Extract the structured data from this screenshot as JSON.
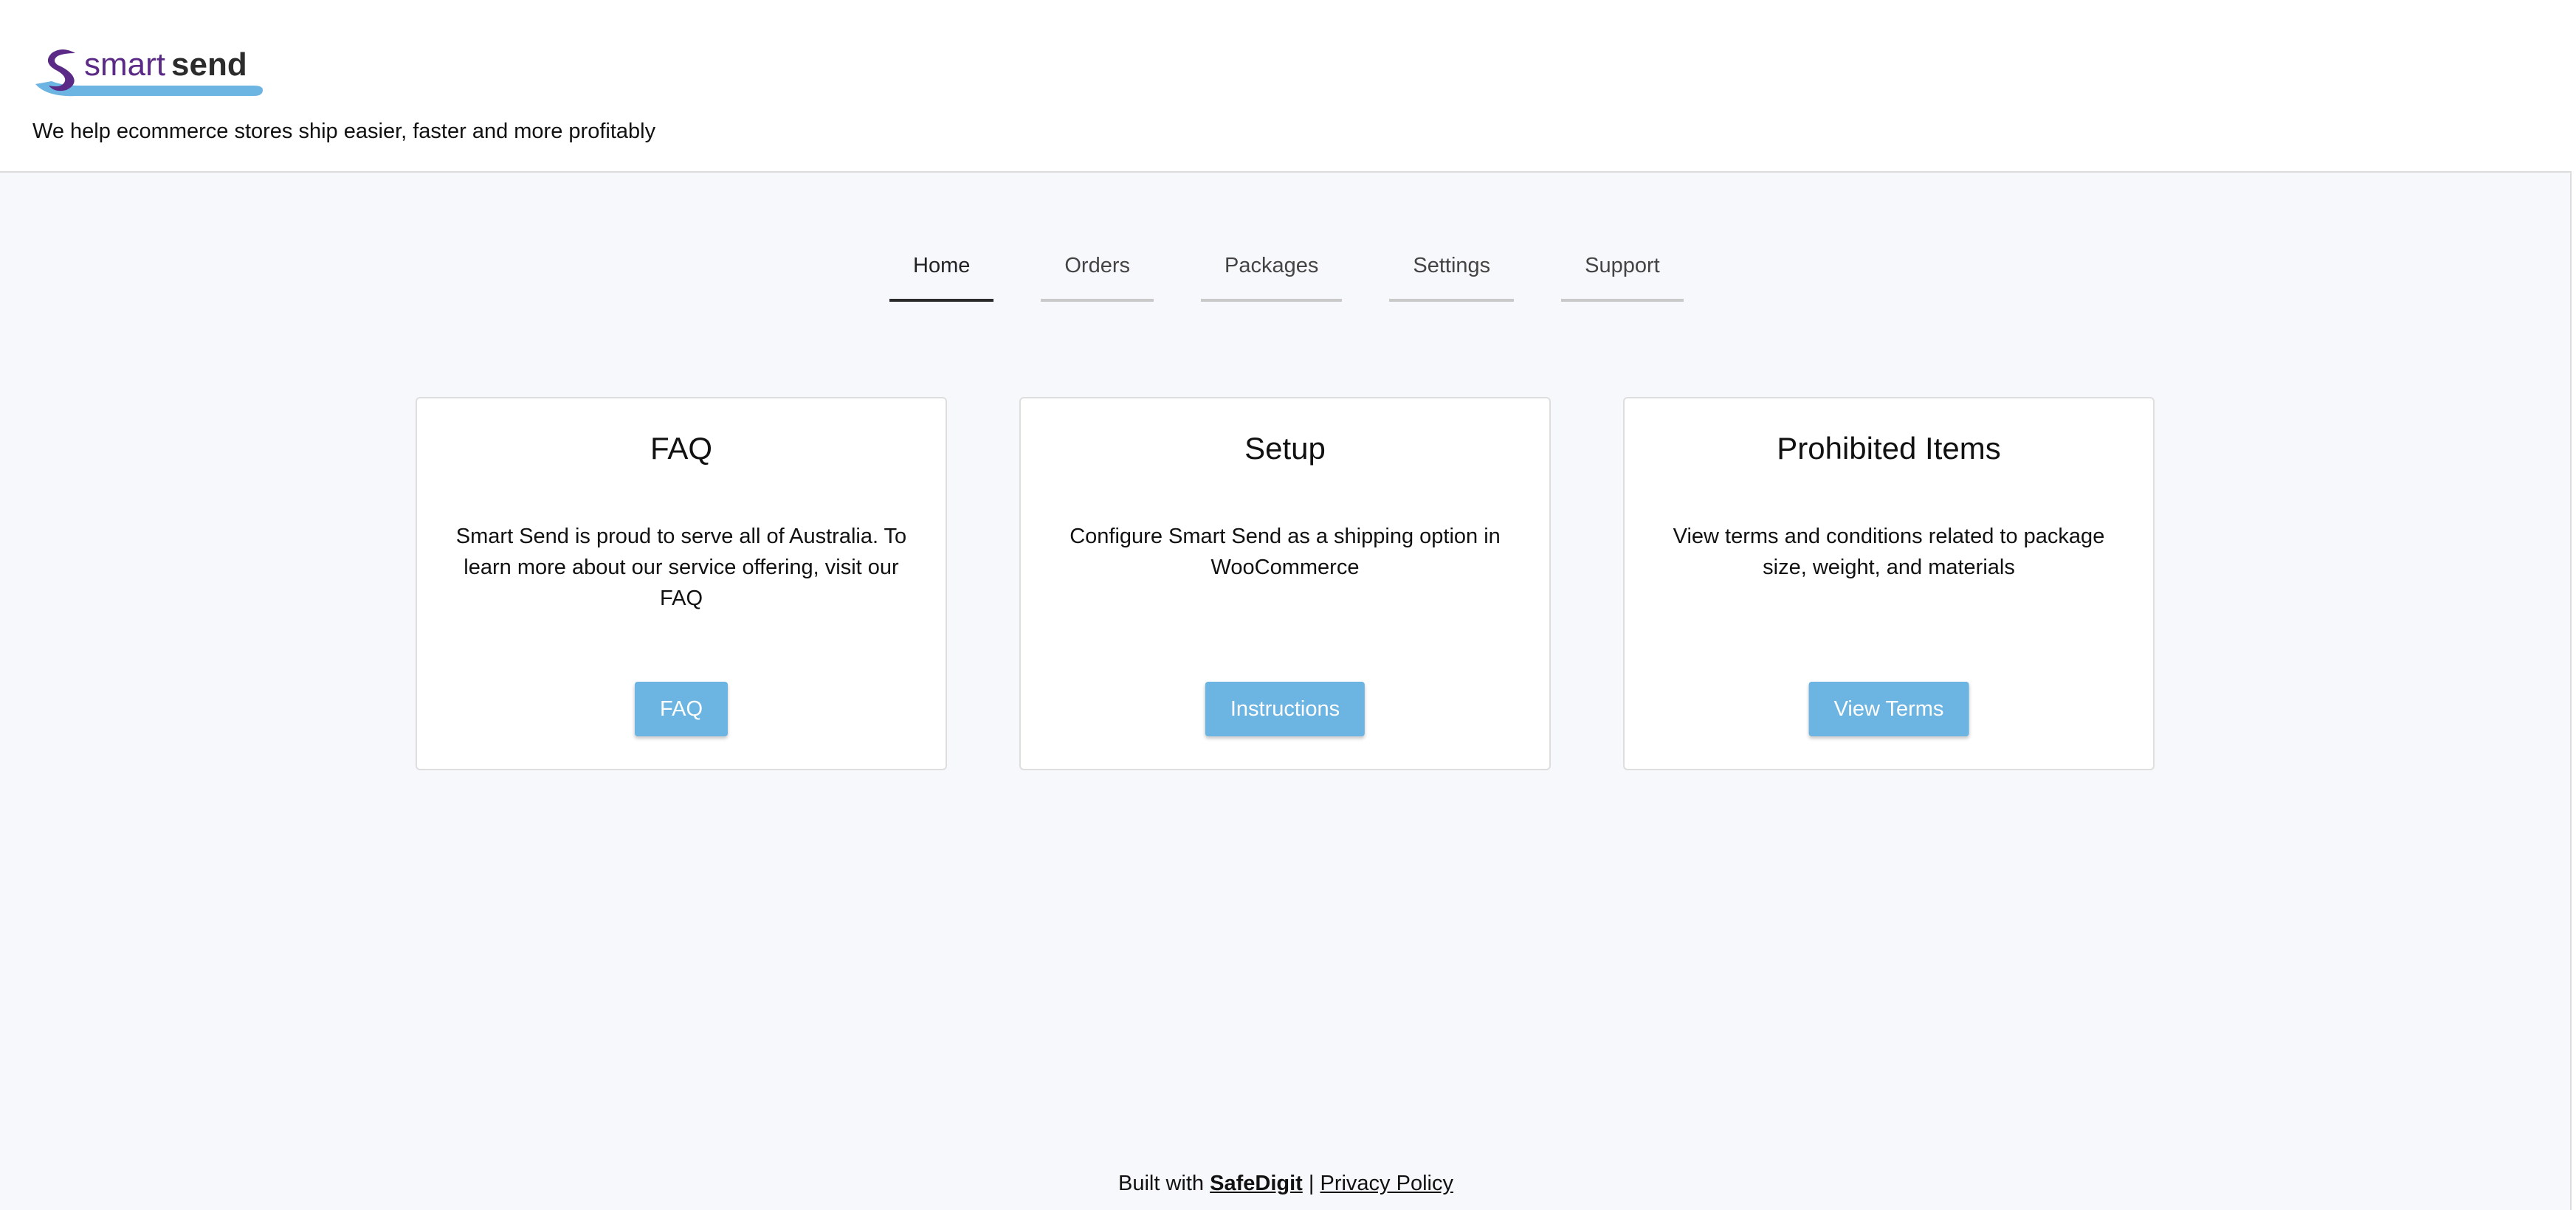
{
  "header": {
    "logo_text_light": "smart",
    "logo_text_bold": "send",
    "tagline": "We help ecommerce stores ship easier, faster and more profitably"
  },
  "nav": {
    "tabs": [
      {
        "label": "Home",
        "active": true
      },
      {
        "label": "Orders",
        "active": false
      },
      {
        "label": "Packages",
        "active": false
      },
      {
        "label": "Settings",
        "active": false
      },
      {
        "label": "Support",
        "active": false
      }
    ]
  },
  "cards": [
    {
      "title": "FAQ",
      "text": "Smart Send is proud to serve all of Australia. To learn more about our service offering, visit our FAQ",
      "button": "FAQ"
    },
    {
      "title": "Setup",
      "text": "Configure Smart Send as a shipping option in WooCommerce",
      "button": "Instructions"
    },
    {
      "title": "Prohibited Items",
      "text": "View terms and conditions related to package size, weight, and materials",
      "button": "View Terms"
    }
  ],
  "footer": {
    "built_with": "Built with",
    "brand": "SafeDigit",
    "separator": "|",
    "privacy": "Privacy Policy"
  },
  "colors": {
    "accent": "#6cb4e2",
    "logo_purple": "#5b2a86",
    "logo_blue": "#6cb4e2",
    "background": "#f7f8fb"
  }
}
